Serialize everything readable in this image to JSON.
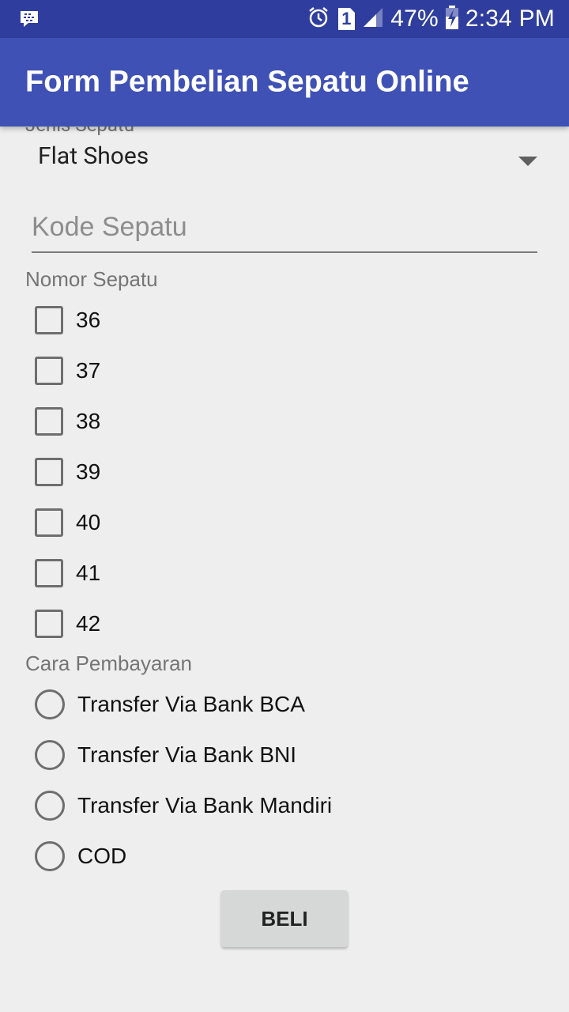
{
  "status_bar": {
    "battery_percent": "47%",
    "time": "2:34 PM",
    "sim_label": "1",
    "icons": [
      "bbm-icon",
      "alarm-icon",
      "sim-icon",
      "signal-icon",
      "battery-charging-icon"
    ]
  },
  "app_bar": {
    "title": "Form Pembelian Sepatu Online"
  },
  "form": {
    "jenis_label": "Jenis Sepatu",
    "jenis_value": "Flat Shoes",
    "kode_placeholder": "Kode Sepatu",
    "nomor_label": "Nomor Sepatu",
    "sizes": [
      "36",
      "37",
      "38",
      "39",
      "40",
      "41",
      "42"
    ],
    "pembayaran_label": "Cara Pembayaran",
    "payments": [
      "Transfer Via Bank BCA",
      "Transfer Via Bank BNI",
      "Transfer Via Bank Mandiri",
      "COD"
    ],
    "submit_label": "BELI"
  },
  "colors": {
    "primary": "#3f51b5",
    "primary_dark": "#2f3e9e",
    "background": "#eeeeee"
  }
}
